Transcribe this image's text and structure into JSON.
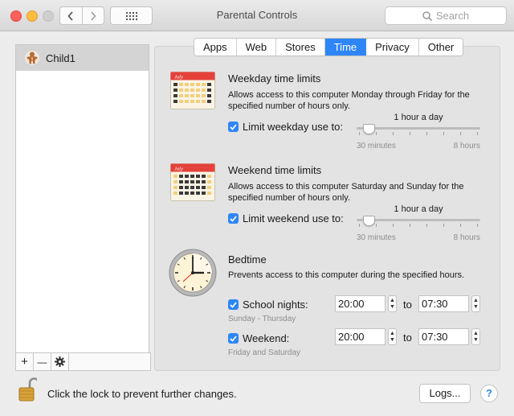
{
  "window": {
    "title": "Parental Controls"
  },
  "toolbar": {
    "back_icon": "chevron-left-icon",
    "forward_icon": "chevron-right-icon",
    "grid_icon": "grid-icon"
  },
  "search": {
    "placeholder": "Search"
  },
  "sidebar": {
    "users": [
      {
        "name": "Child1"
      }
    ]
  },
  "sidebar_buttons": {
    "add": "+",
    "remove": "—",
    "actions_icon": "gear-icon"
  },
  "tabs": [
    {
      "label": "Apps",
      "active": false
    },
    {
      "label": "Web",
      "active": false
    },
    {
      "label": "Stores",
      "active": false
    },
    {
      "label": "Time",
      "active": true
    },
    {
      "label": "Privacy",
      "active": false
    },
    {
      "label": "Other",
      "active": false
    }
  ],
  "weekday": {
    "heading": "Weekday time limits",
    "desc1": "Allows access to this computer Monday through Friday for the",
    "desc2": "specified number of hours only.",
    "checkbox_label": "Limit weekday use to:",
    "checked": true,
    "value_label": "1 hour a day",
    "min_label": "30 minutes",
    "max_label": "8 hours",
    "calendar_month": "July"
  },
  "weekend": {
    "heading": "Weekend time limits",
    "desc1": "Allows access to this computer Saturday and Sunday for the",
    "desc2": "specified number of hours only.",
    "checkbox_label": "Limit weekend use to:",
    "checked": true,
    "value_label": "1 hour a day",
    "min_label": "30 minutes",
    "max_label": "8 hours",
    "calendar_month": "July"
  },
  "bedtime": {
    "heading": "Bedtime",
    "desc": "Prevents access to this computer during the specified hours.",
    "school": {
      "label": "School nights:",
      "sub": "Sunday - Thursday",
      "from": "20:00",
      "to_word": "to",
      "to": "07:30",
      "checked": true
    },
    "weekend": {
      "label": "Weekend:",
      "sub": "Friday and Saturday",
      "from": "20:00",
      "to_word": "to",
      "to": "07:30",
      "checked": true
    }
  },
  "footer": {
    "lock_message": "Click the lock to prevent further changes.",
    "logs_button": "Logs...",
    "help_button": "?"
  },
  "colors": {
    "accent": "#2e86f6",
    "calendar_red": "#e3413a"
  }
}
